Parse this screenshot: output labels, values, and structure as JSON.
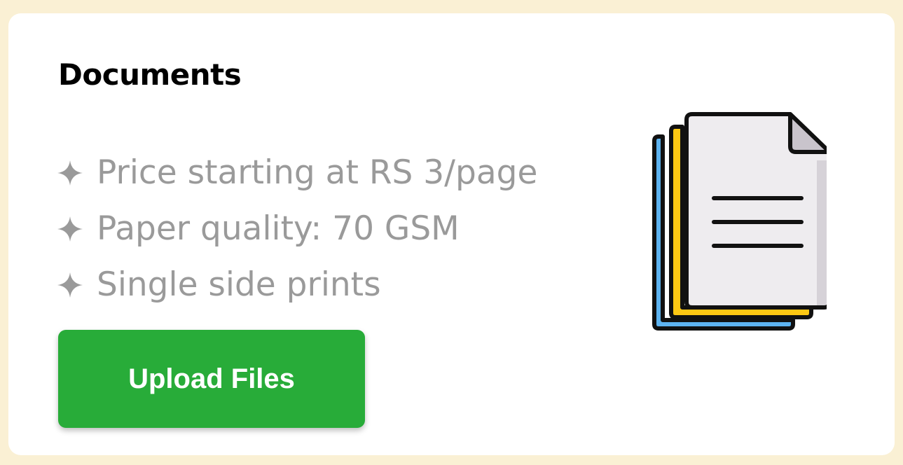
{
  "card": {
    "title": "Documents",
    "features": [
      "Price starting at RS 3/page",
      "Paper quality: 70 GSM",
      "Single side prints"
    ],
    "feature_icon": "sparkle-icon",
    "upload_button_label": "Upload Files",
    "illustration_icon": "documents-icon"
  },
  "colors": {
    "page_background": "#faf0d4",
    "card_background": "#ffffff",
    "button": "#28ac39",
    "feature_text": "#9a9a9a",
    "sheet_back": "#5db3f0",
    "sheet_middle": "#fdc813",
    "sheet_front": "#eeecef"
  }
}
